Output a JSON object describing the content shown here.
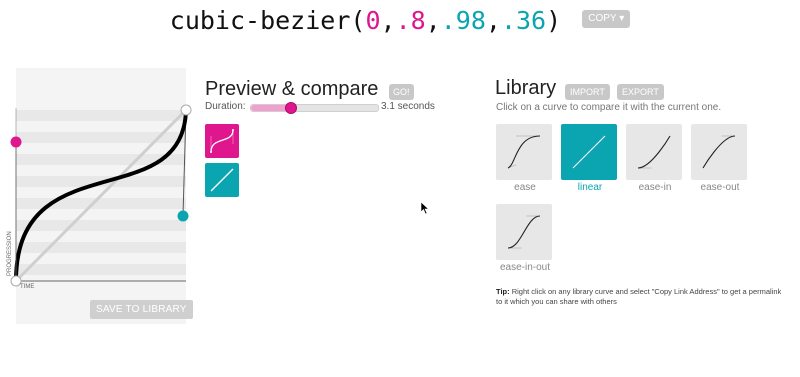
{
  "header": {
    "func": "cubic-bezier(",
    "comma": ",",
    "p1x": "0",
    "p1y": ".8",
    "p2x": ".98",
    "p2y": ".36",
    "close": ")",
    "copy_label": "COPY",
    "copy_chevron": "▾"
  },
  "editor": {
    "ylabel": "PROGRESSION",
    "xlabel": "TIME",
    "save_label": "SAVE TO LIBRARY",
    "p1_color": "#e0168f",
    "p2_color": "#0aa5b0"
  },
  "preview": {
    "title": "Preview & compare",
    "go_label": "GO!",
    "duration_label": "Duration:",
    "duration_value": "3.1 seconds",
    "duration_fraction": 0.31
  },
  "library": {
    "title": "Library",
    "import_label": "IMPORT",
    "export_label": "EXPORT",
    "subtitle": "Click on a curve to compare it with the current one.",
    "items": [
      {
        "label": "ease",
        "active": false,
        "curve": [
          0.25,
          0.1,
          0.25,
          1
        ]
      },
      {
        "label": "linear",
        "active": true,
        "curve": [
          0,
          0,
          1,
          1
        ]
      },
      {
        "label": "ease-in",
        "active": false,
        "curve": [
          0.42,
          0,
          1,
          1
        ]
      },
      {
        "label": "ease-out",
        "active": false,
        "curve": [
          0,
          0,
          0.58,
          1
        ]
      },
      {
        "label": "ease-in-out",
        "active": false,
        "curve": [
          0.42,
          0,
          0.58,
          1
        ]
      }
    ],
    "tip_label": "Tip:",
    "tip_text": " Right click on any library curve and select \"Copy Link Address\" to get a permalink to it which you can share with others"
  },
  "colors": {
    "accent_pink": "#e0168f",
    "accent_teal": "#0aa5b0",
    "button_gray": "#c8c8c8"
  }
}
